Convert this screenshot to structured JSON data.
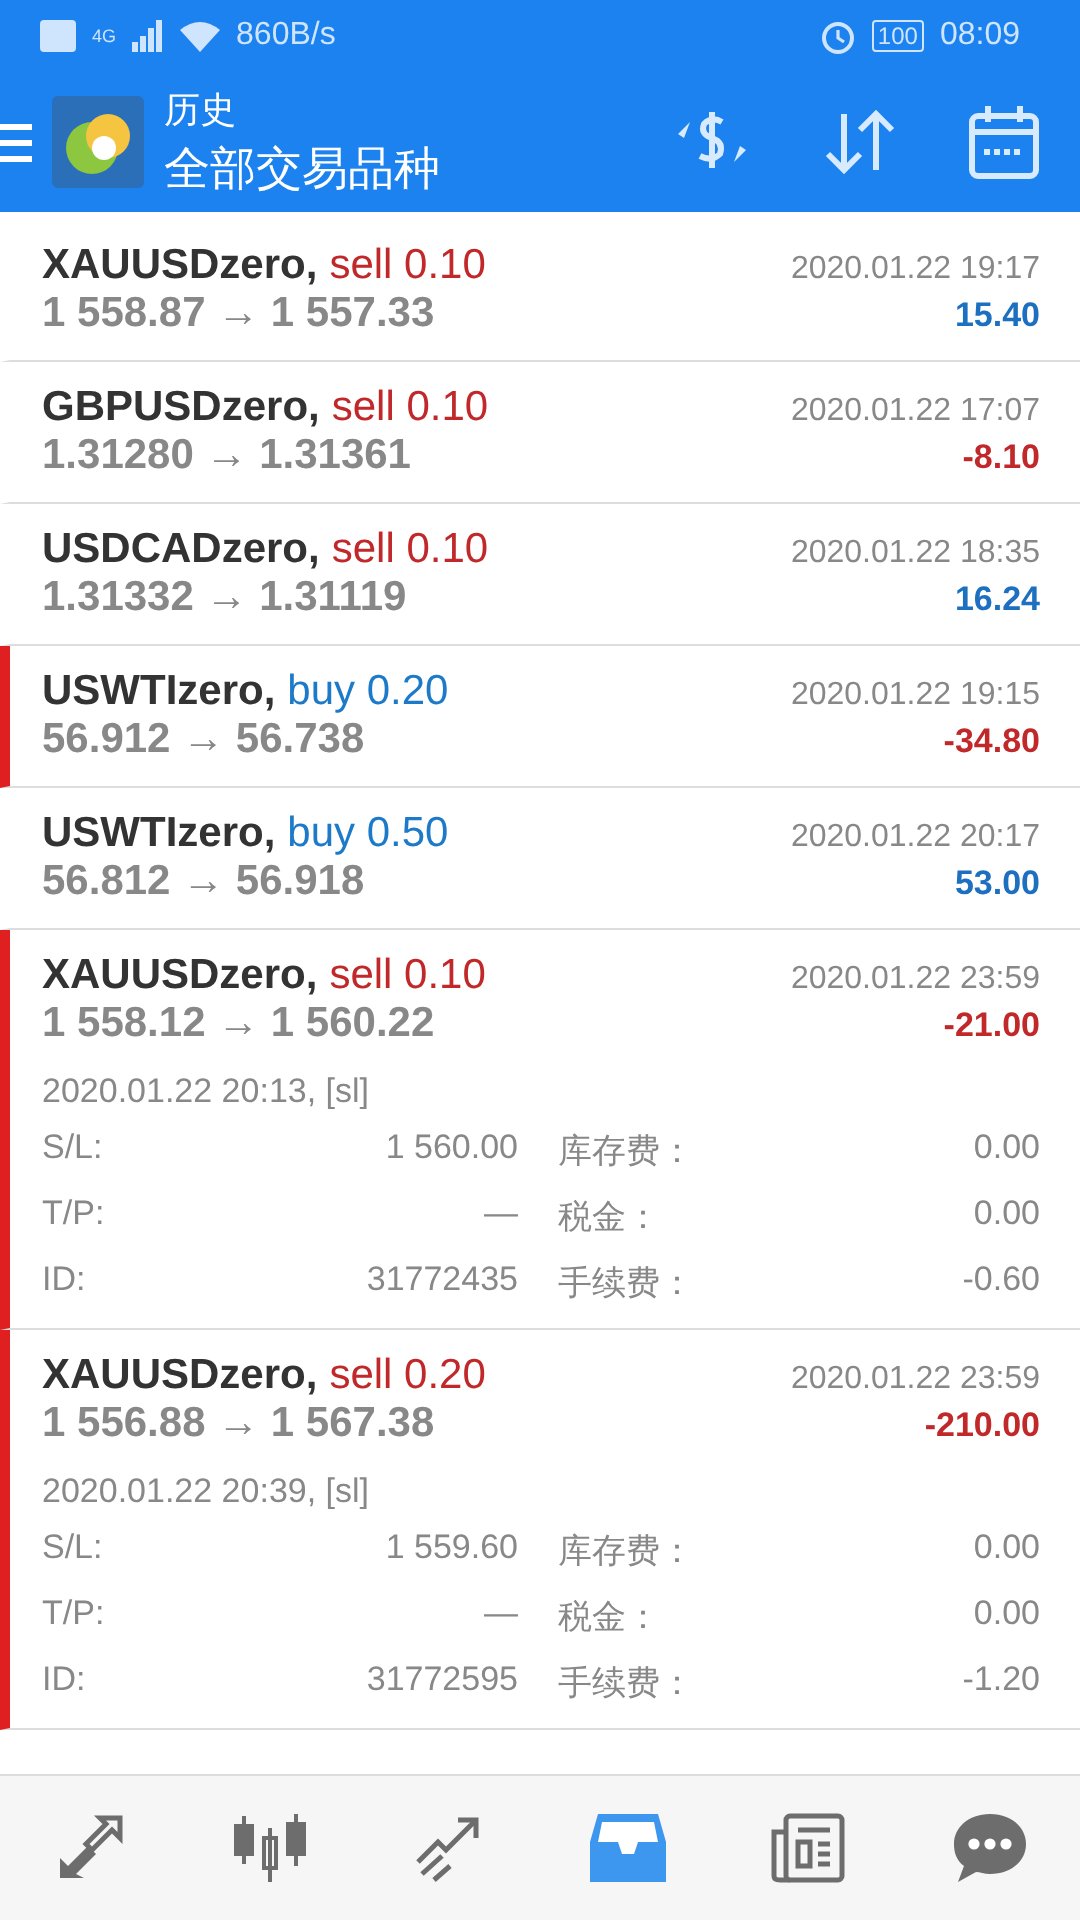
{
  "status_bar": {
    "network": "4G",
    "speed": "860B/s",
    "battery": "100",
    "time": "08:09"
  },
  "app_bar": {
    "title": "历史",
    "subtitle": "全部交易品种"
  },
  "deals": [
    {
      "symbol": "XAUUSDzero,",
      "side": "sell",
      "volume": "0.10",
      "prices": "1 558.87 → 1 557.33",
      "time": "2020.01.22 19:17",
      "profit": "15.40",
      "marked": false
    },
    {
      "symbol": "GBPUSDzero,",
      "side": "sell",
      "volume": "0.10",
      "prices": "1.31280 → 1.31361",
      "time": "2020.01.22 17:07",
      "profit": "-8.10",
      "marked": false
    },
    {
      "symbol": "USDCADzero,",
      "side": "sell",
      "volume": "0.10",
      "prices": "1.31332 → 1.31119",
      "time": "2020.01.22 18:35",
      "profit": "16.24",
      "marked": false
    },
    {
      "symbol": "USWTIzero,",
      "side": "buy",
      "volume": "0.20",
      "prices": "56.912 → 56.738",
      "time": "2020.01.22 19:15",
      "profit": "-34.80",
      "marked": true
    },
    {
      "symbol": "USWTIzero,",
      "side": "buy",
      "volume": "0.50",
      "prices": "56.812 → 56.918",
      "time": "2020.01.22 20:17",
      "profit": "53.00",
      "marked": false
    },
    {
      "symbol": "XAUUSDzero,",
      "side": "sell",
      "volume": "0.10",
      "prices": "1 558.12 → 1 560.22",
      "time": "2020.01.22 23:59",
      "profit": "-21.00",
      "marked": true,
      "open_time": "2020.01.22 20:13, [sl]",
      "details": [
        [
          "S/L:",
          "1 560.00",
          "库存费：",
          "0.00"
        ],
        [
          "T/P:",
          "—",
          "税金：",
          "0.00"
        ],
        [
          "ID:",
          "31772435",
          "手续费：",
          "-0.60"
        ]
      ]
    },
    {
      "symbol": "XAUUSDzero,",
      "side": "sell",
      "volume": "0.20",
      "prices": "1 556.88 → 1 567.38",
      "time": "2020.01.22 23:59",
      "profit": "-210.00",
      "marked": true,
      "open_time": "2020.01.22 20:39, [sl]",
      "details": [
        [
          "S/L:",
          "1 559.60",
          "库存费：",
          "0.00"
        ],
        [
          "T/P:",
          "—",
          "税金：",
          "0.00"
        ],
        [
          "ID:",
          "31772595",
          "手续费：",
          "-1.20"
        ]
      ]
    }
  ],
  "nav": [
    {
      "kind": "quotes",
      "selected": false
    },
    {
      "kind": "chart",
      "selected": false
    },
    {
      "kind": "trade",
      "selected": false
    },
    {
      "kind": "history",
      "selected": true
    },
    {
      "kind": "news",
      "selected": false
    },
    {
      "kind": "chat",
      "selected": false
    }
  ]
}
